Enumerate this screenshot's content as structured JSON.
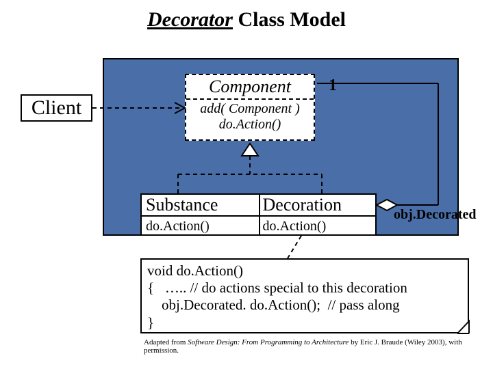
{
  "title": {
    "underlined": "Decorator",
    "rest": " Class Model"
  },
  "client": {
    "label": "Client"
  },
  "component": {
    "name": "Component",
    "method_add": "add( Component )",
    "method_do": "do.Action()"
  },
  "multiplicity_one": "1",
  "subclasses": {
    "substance_name": "Substance",
    "substance_method": "do.Action()",
    "decoration_name": "Decoration",
    "decoration_method": "do.Action()"
  },
  "aggregation_role": "obj.Decorated",
  "code_note": "void do.Action()\n{   ….. // do actions special to this decoration\n    obj.Decorated. do.Action();  // pass along\n}",
  "attribution": {
    "prefix": "Adapted from ",
    "book": "Software Design: From Programming to Architecture",
    "suffix": " by Eric J. Braude (Wiley 2003), with permission."
  }
}
